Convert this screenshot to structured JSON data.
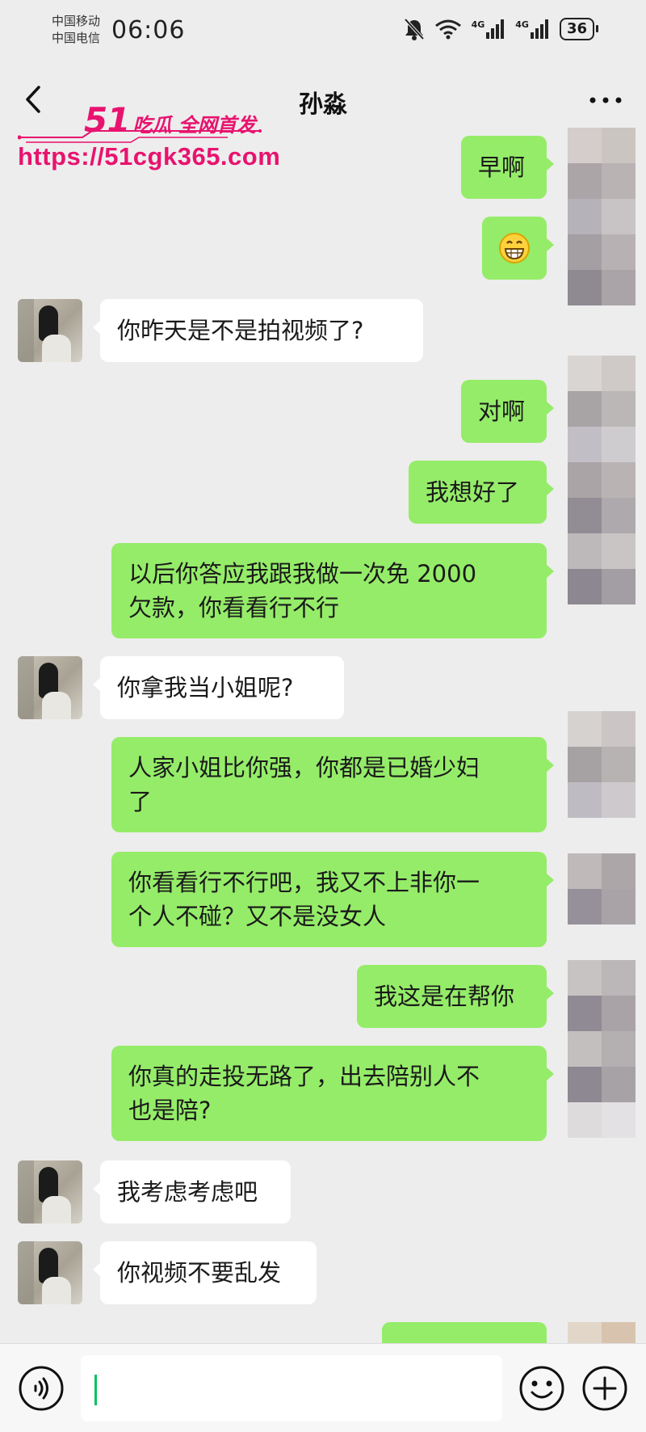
{
  "status_bar": {
    "carrier_1": "中国移动",
    "carrier_2": "中国电信",
    "time": "06:06",
    "battery": "36",
    "sim1_network": "4G",
    "sim2_network": "4G"
  },
  "header": {
    "title": "孙淼",
    "back_icon": "chevron-left-icon",
    "more_icon": "more-dots-icon"
  },
  "watermark": {
    "brand_number": "51",
    "brand_text": "吃瓜 全网首发",
    "url": "https://51cgk365.com"
  },
  "messages": [
    {
      "side": "out",
      "lines": [
        "早啊"
      ]
    },
    {
      "side": "out",
      "emoji": "grinning-face-icon"
    },
    {
      "side": "in",
      "lines": [
        "你昨天是不是拍视频了?"
      ]
    },
    {
      "side": "out",
      "lines": [
        "对啊"
      ]
    },
    {
      "side": "out",
      "lines": [
        "我想好了"
      ]
    },
    {
      "side": "out",
      "lines": [
        "以后你答应我跟我做一次免 2000",
        "欠款，你看看行不行"
      ]
    },
    {
      "side": "in",
      "lines": [
        "你拿我当小姐呢?"
      ]
    },
    {
      "side": "out",
      "lines": [
        "人家小姐比你强，你都是已婚少妇",
        "了"
      ]
    },
    {
      "side": "out",
      "lines": [
        "你看看行不行吧，我又不上非你一",
        "个人不碰？又不是没女人"
      ]
    },
    {
      "side": "out",
      "lines": [
        "我这是在帮你"
      ]
    },
    {
      "side": "out",
      "lines": [
        "你真的走投无路了，出去陪别人不",
        "也是陪?"
      ]
    },
    {
      "side": "in",
      "lines": [
        "我考虑考虑吧"
      ]
    },
    {
      "side": "in",
      "lines": [
        "你视频不要乱发"
      ]
    }
  ],
  "input_bar": {
    "voice_icon": "voice-icon",
    "emoji_icon": "emoji-icon",
    "plus_icon": "plus-icon",
    "input_value": ""
  },
  "colors": {
    "outgoing_bubble": "#95ec69",
    "incoming_bubble": "#ffffff",
    "background": "#ededed",
    "watermark": "#e8136f"
  }
}
